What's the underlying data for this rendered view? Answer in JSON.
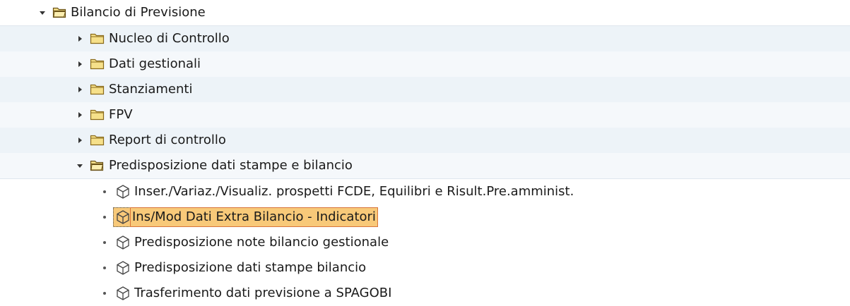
{
  "tree": {
    "root": {
      "label": "Bilancio di Previsione",
      "icon": "folder-open-icon",
      "expanded": true
    },
    "folders": [
      {
        "label": "Nucleo di Controllo",
        "icon": "folder-icon",
        "expanded": false
      },
      {
        "label": "Dati gestionali",
        "icon": "folder-icon",
        "expanded": false
      },
      {
        "label": "Stanziamenti",
        "icon": "folder-icon",
        "expanded": false
      },
      {
        "label": "FPV",
        "icon": "folder-icon",
        "expanded": false
      },
      {
        "label": "Report di controllo",
        "icon": "folder-icon",
        "expanded": false
      },
      {
        "label": "Predisposizione dati stampe e bilancio",
        "icon": "folder-open-icon",
        "expanded": true
      }
    ],
    "transactions": [
      {
        "label": "Inser./Variaz./Visualiz. prospetti FCDE, Equilibri e Risult.Pre.amminist.",
        "icon": "transaction-cube-icon",
        "selected": false
      },
      {
        "label": "Ins/Mod Dati Extra Bilancio - Indicatori",
        "icon": "transaction-cube-icon",
        "selected": true
      },
      {
        "label": "Predisposizione note bilancio gestionale",
        "icon": "transaction-cube-icon",
        "selected": false
      },
      {
        "label": "Predisposizione dati stampe bilancio",
        "icon": "transaction-cube-icon",
        "selected": false
      },
      {
        "label": "Trasferimento dati previsione a SPAGOBI",
        "icon": "transaction-cube-icon",
        "selected": false
      }
    ],
    "colors": {
      "selection_fill": "#f8c979",
      "selection_border": "#d8733a",
      "band_a": "#edf3f8",
      "band_b": "#f5f8fb",
      "folder_fill": "#f6e08a",
      "folder_stroke": "#8a6a1a"
    }
  }
}
